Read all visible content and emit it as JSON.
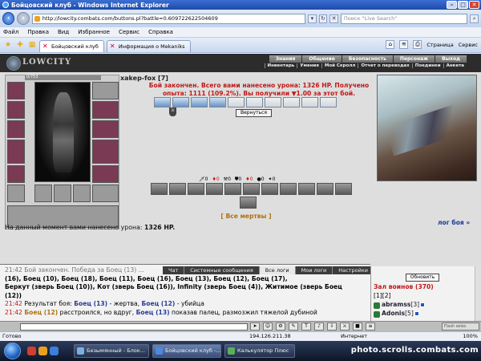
{
  "window": {
    "title": "Бойцовский клуб - Windows Internet Explorer"
  },
  "addressbar": {
    "url": "http://lowcity.combats.com/buttons.pl?battle=0.609722622504609",
    "search_placeholder": "Поиск \"Live Search\""
  },
  "menu": [
    "Файл",
    "Правка",
    "Вид",
    "Избранное",
    "Сервис",
    "Справка"
  ],
  "tabs": [
    {
      "label": "Бойцовский клуб",
      "active": true
    },
    {
      "label": "Информация о Mekaniks",
      "active": false
    }
  ],
  "browser_tools": {
    "page": "Страница",
    "tools": "Сервис"
  },
  "game": {
    "logo": "LOWCITY",
    "top_menu": [
      "Знания",
      "Общение",
      "Безопасность",
      "Персонаж",
      "Выход"
    ],
    "sub_menu": [
      "Инвентарь",
      "Умения",
      "Мой Скролл",
      "Отчет о переводах",
      "Поединки",
      "Анкета"
    ],
    "hp": "0/753",
    "hp_fraction": 0,
    "nickname": "xakep-fox [7]",
    "battle_message": "Бой закончен. Всего вами нанесено урона: 1326 HP. Получено опыта: 1111 (109.2%). Вы получили",
    "win_amount": "▼1.00",
    "battle_message_end": "за этот бой.",
    "back_button": "Вернуться",
    "counters": [
      "0",
      "0",
      "0",
      "0",
      "0",
      "0",
      "0"
    ],
    "all_dead": "[ Все мертвы ]",
    "fight_log_link": "лог боя »",
    "damage_label": "На данный момент вами нанесено урона:",
    "damage_value": "1326 HP."
  },
  "chat": {
    "tabs": [
      {
        "label": "Чат",
        "active": false
      },
      {
        "label": "Системные сообщения",
        "active": false
      },
      {
        "label": "Все логи",
        "active": true
      },
      {
        "label": "Мои логи",
        "active": false
      },
      {
        "label": "Настройки",
        "active": false
      }
    ],
    "line0": "21:42 Бой закончен. Победа за Боец (13) ...",
    "line1": "(16), Боец (10), Боец (18), Боец (11), Боец (16), Боец (13), Боец (12), Боец (17),",
    "line2": "Беркут (зверь Боец (10)), Кот (зверь Боец (16)), Infinity (зверь Боец (4)), Житимое (зверь Боец",
    "line3": "(12))",
    "line4_time": "21:42",
    "line4_a": "Результат боя:",
    "line4_name1": "Боец (13)",
    "line4_b": "- жертва,",
    "line4_name2": "Боец (12)",
    "line4_c": "- убийца",
    "line5_time": "21:42",
    "line5_name1": "Боец (12)",
    "line5_a": "расстроился, но вдруг,",
    "line5_name2": "Боец (13)",
    "line5_b": "показав палец, размозжил тяжелой дубиной"
  },
  "sidebar": {
    "refresh": "Обновить",
    "hall": "Зал воинов (370)",
    "pages": "[1][2]",
    "users": [
      {
        "name": "abramss",
        "level": "[3]"
      },
      {
        "name": "Adonis",
        "level": "[5]"
      }
    ],
    "flash_select": "Flash selec"
  },
  "statusbar": {
    "status": "Готово",
    "ip": "194.126.211.38",
    "zone": "Интернет",
    "zoom": "100%"
  },
  "taskbar": {
    "items": [
      {
        "label": "Безымянный - Блок..."
      },
      {
        "label": "Бойцовский клуб -..."
      },
      {
        "label": "Калькулятор Плюс"
      }
    ],
    "watermark": "photo.scrolls.combats.com"
  }
}
